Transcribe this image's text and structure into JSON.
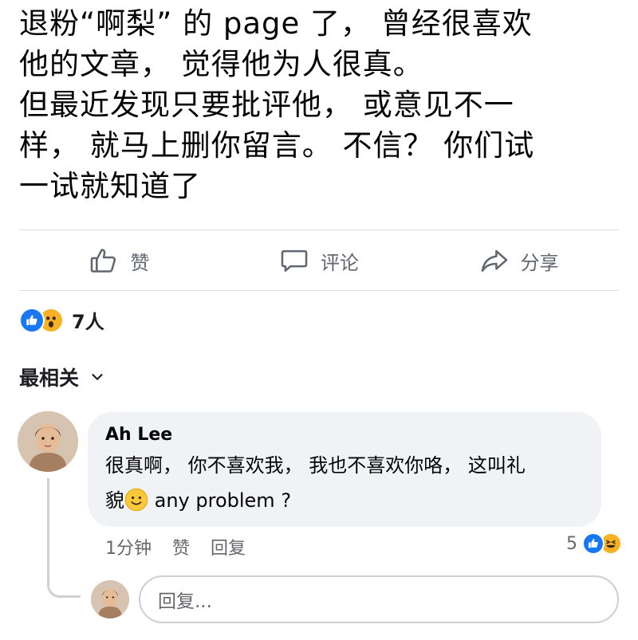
{
  "post": {
    "lines": [
      "退粉“啊梨” 的 page 了， 曾经很喜欢",
      "他的文章， 觉得他为人很真。",
      "但最近发现只要批评他， 或意见不一",
      "样， 就马上删你留言。 不信？ 你们试",
      "一试就知道了"
    ]
  },
  "actions": {
    "like": "赞",
    "comment": "评论",
    "share": "分享"
  },
  "reactions": {
    "count": "7人",
    "icons": [
      "like-icon",
      "wow-icon"
    ],
    "like_color": "#1877f2",
    "emoji_color": "#f7b125"
  },
  "sort": {
    "label": "最相关"
  },
  "comment": {
    "author": "Ah Lee",
    "line1": "很真啊， 你不喜欢我， 我也不喜欢你咯， 这叫礼",
    "line2_prefix": "貌",
    "line2_suffix": " any problem ?",
    "time": "1分钟",
    "like": "赞",
    "reply": "回复",
    "reaction_count": "5",
    "reaction_icons": [
      "like-icon",
      "haha-icon"
    ]
  },
  "reply_box": {
    "placeholder": "回复..."
  }
}
